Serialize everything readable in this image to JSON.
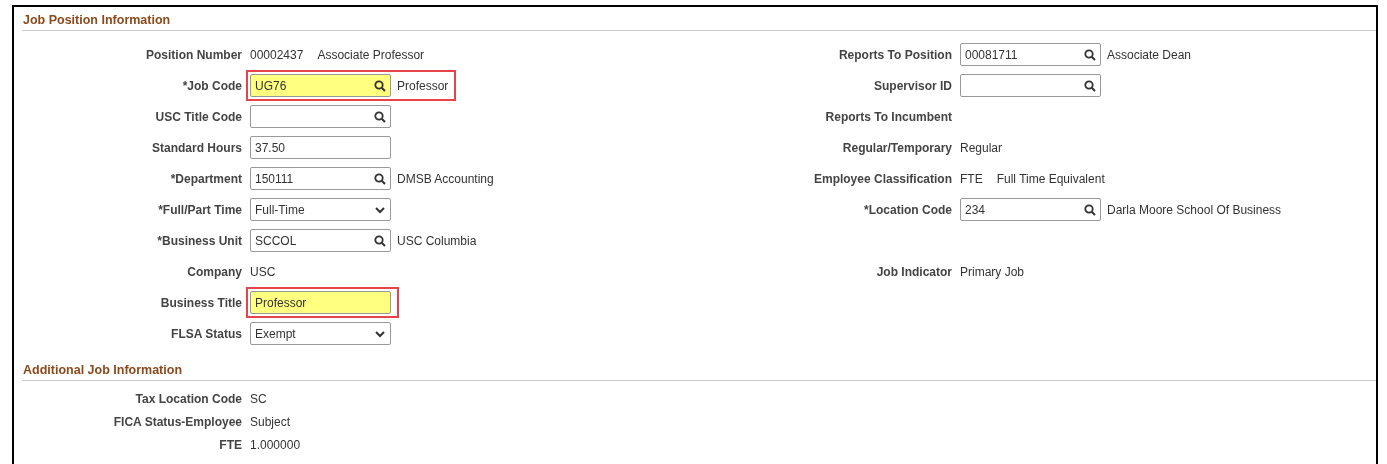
{
  "sections": [
    {
      "title": "Job Position Information",
      "rows": [
        {
          "left": {
            "kind": "text",
            "label": "Position Number",
            "value": "00002437",
            "description": "Associate Professor"
          },
          "right": {
            "kind": "lookup",
            "label": "Reports To Position",
            "value": "00081711",
            "description": "Associate Dean"
          }
        },
        {
          "left": {
            "kind": "lookup",
            "label": "*Job Code",
            "value": "UG76",
            "description": "Professor",
            "highlighted": true
          },
          "right": {
            "kind": "lookup",
            "label": "Supervisor ID"
          }
        },
        {
          "left": {
            "kind": "lookup",
            "label": "USC Title Code"
          },
          "right": {
            "kind": "text",
            "label": "Reports To Incumbent"
          }
        },
        {
          "left": {
            "kind": "input",
            "label": "Standard Hours",
            "value": "37.50"
          },
          "right": {
            "kind": "text",
            "label": "Regular/Temporary",
            "value": "Regular"
          }
        },
        {
          "left": {
            "kind": "lookup",
            "label": "*Department",
            "value": "150111",
            "description": "DMSB Accounting"
          },
          "right": {
            "kind": "text",
            "label": "Employee Classification",
            "value": "FTE",
            "description": "Full Time Equivalent"
          }
        },
        {
          "left": {
            "kind": "select",
            "label": "*Full/Part Time",
            "value": "Full-Time"
          },
          "right": {
            "kind": "lookup",
            "label": "*Location Code",
            "value": "234",
            "description": "Darla Moore School Of Business"
          }
        },
        {
          "left": {
            "kind": "lookup",
            "label": "*Business Unit",
            "value": "SCCOL",
            "description": "USC Columbia"
          }
        },
        {
          "left": {
            "kind": "text",
            "label": "Company",
            "value": "USC"
          },
          "right": {
            "kind": "text",
            "label": "Job Indicator",
            "value": "Primary Job"
          }
        },
        {
          "left": {
            "kind": "input",
            "label": "Business Title",
            "value": "Professor",
            "highlighted": true
          }
        },
        {
          "left": {
            "kind": "select",
            "label": "FLSA Status",
            "value": "Exempt"
          }
        }
      ]
    },
    {
      "title": "Additional Job Information",
      "rows": [
        {
          "left": {
            "kind": "text",
            "label": "Tax Location Code",
            "value": "SC"
          }
        },
        {
          "left": {
            "kind": "text",
            "label": "FICA Status-Employee",
            "value": "Subject"
          }
        },
        {
          "left": {
            "kind": "text",
            "label": "FTE",
            "value": "1.000000"
          }
        }
      ]
    }
  ]
}
